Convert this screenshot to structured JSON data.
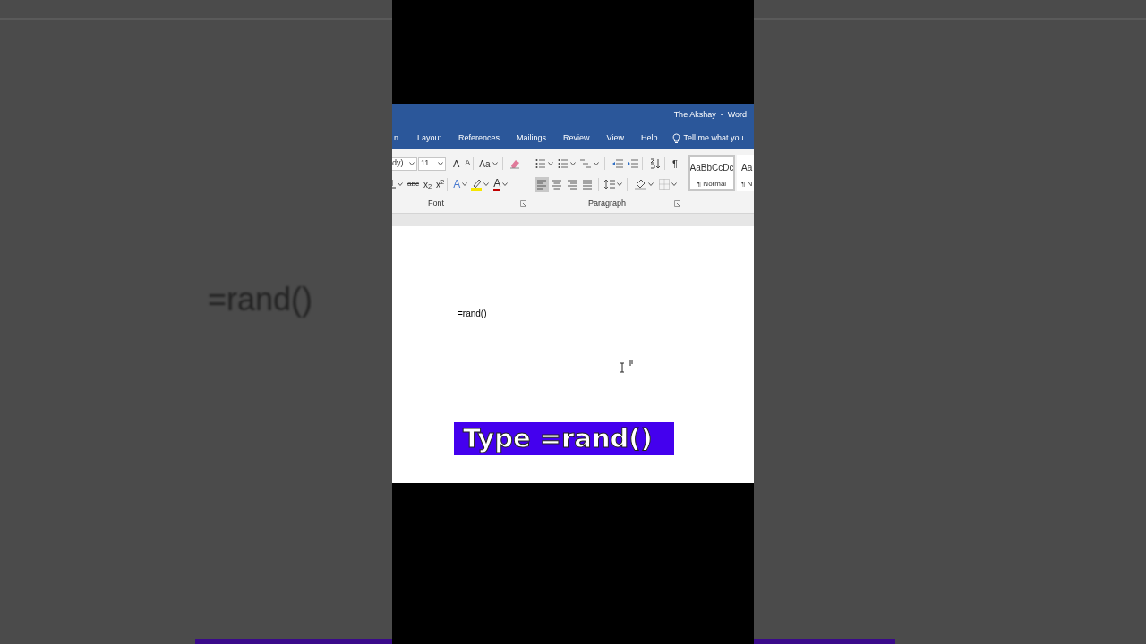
{
  "backdrop": {
    "text": "=rand()"
  },
  "window": {
    "title": "The Akshay  -  Word"
  },
  "tabs": [
    {
      "label": "n",
      "selected": false
    },
    {
      "label": "Layout",
      "selected": false
    },
    {
      "label": "References",
      "selected": false
    },
    {
      "label": "Mailings",
      "selected": false
    },
    {
      "label": "Review",
      "selected": false
    },
    {
      "label": "View",
      "selected": false
    },
    {
      "label": "Help",
      "selected": false
    }
  ],
  "tell_me": {
    "placeholder": "Tell me what you"
  },
  "font_group": {
    "font_name": "dy)",
    "font_size": "11",
    "grow": "A",
    "shrink": "A",
    "change_case": "Aa",
    "strikethrough": "abc",
    "subscript": "x$_{2}$",
    "superscript": "x$^{2}$",
    "text_effects": "A",
    "font_color": "A",
    "label": "Font"
  },
  "paragraph_group": {
    "show_marks": "¶",
    "label": "Paragraph",
    "alignments": [
      {
        "kind": "left",
        "selected": true
      },
      {
        "kind": "center",
        "selected": false
      },
      {
        "kind": "right",
        "selected": false
      },
      {
        "kind": "justify",
        "selected": false
      }
    ]
  },
  "styles": [
    {
      "preview": "AaBbCcDc",
      "name": "¶ Normal",
      "selected": true
    },
    {
      "preview": "Aa",
      "name": "¶ N",
      "selected": false
    }
  ],
  "document": {
    "text": "=rand()"
  },
  "caption": "Type =rand()"
}
